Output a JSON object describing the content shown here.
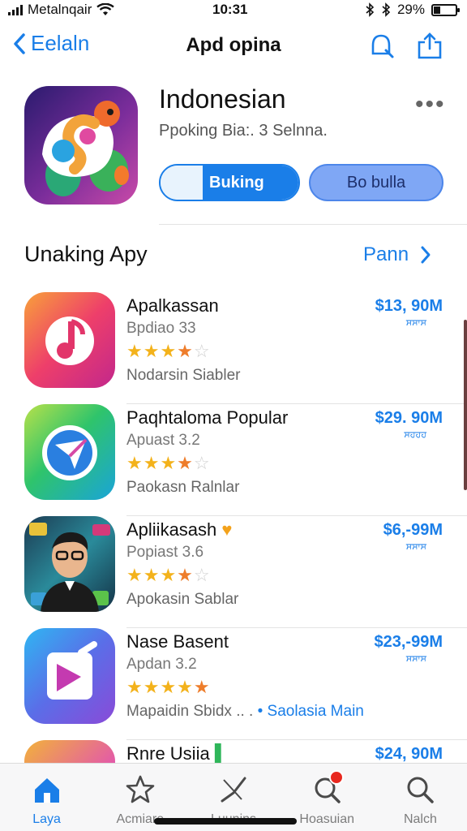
{
  "status_bar": {
    "carrier": "Metalnqair",
    "time": "10:31",
    "battery": "29%",
    "battery_level": 0.29
  },
  "nav": {
    "back_label": "Eelaln",
    "title": "Apd opina"
  },
  "hero": {
    "title": "Indonesian",
    "subtitle": "Ppoking Bia:. 3 Selnna.",
    "primary_button": "Buking",
    "secondary_button": "Bo bulla"
  },
  "section": {
    "title": "Unaking Apy",
    "link": "Pann"
  },
  "apps": [
    {
      "name": "Apalkassan",
      "sub": "Bpdiao 33",
      "rating": 3.5,
      "category": "Nodarsin Siabler",
      "tag": "",
      "price": "$13, 90M",
      "unit": "ਸਸਾਸ"
    },
    {
      "name": "Paqhtaloma Popular",
      "sub": "Apuast 3.2",
      "rating": 3.5,
      "category": "Paokasn Ralnlar",
      "tag": "",
      "price": "$29. 90M",
      "unit": "ਸਹਹਹ"
    },
    {
      "name": "Apliikasash",
      "sub": "Popiast 3.6",
      "rating": 3.5,
      "category": "Apokasin Sablar",
      "tag": "",
      "price": "$6,-99M",
      "unit": "ਸਸਾਸ"
    },
    {
      "name": "Nase Basent",
      "sub": "Apdan 3.2",
      "rating": 4.0,
      "category": "Mapaidin Sbidx .. .",
      "tag": "• Saolasia Main",
      "price": "$23,-99M",
      "unit": "ਸਸਾਸ"
    },
    {
      "name": "Rnre Usiia",
      "sub": "",
      "rating": 0,
      "category": "",
      "tag": "",
      "price": "$24, 90M",
      "unit": ""
    }
  ],
  "tabs": [
    {
      "label": "Laya",
      "icon": "home-icon",
      "active": true
    },
    {
      "label": "Acmiare",
      "icon": "star-icon",
      "active": false
    },
    {
      "label": "Luunins",
      "icon": "compass-icon",
      "active": false
    },
    {
      "label": "Hoasuian",
      "icon": "search-badge-icon",
      "active": false
    },
    {
      "label": "Nalch",
      "icon": "search-icon",
      "active": false
    }
  ],
  "colors": {
    "accent": "#1a7ee8",
    "star": "#f3b21b",
    "badge": "#e8281f"
  }
}
